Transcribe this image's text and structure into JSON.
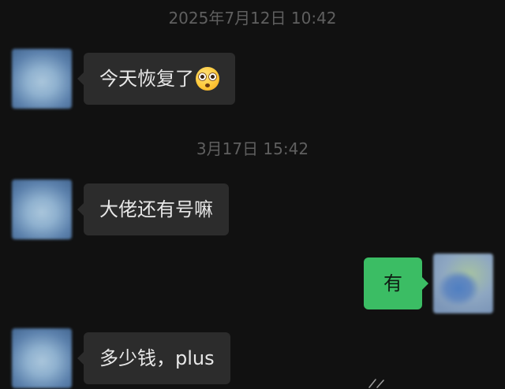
{
  "chat": {
    "messages": [
      {
        "type": "timestamp",
        "text": "2025年7月12日 10:42"
      },
      {
        "type": "incoming",
        "text": "今天恢复了",
        "emoji": "flushed-face-emoji"
      },
      {
        "type": "timestamp",
        "text": "3月17日 15:42"
      },
      {
        "type": "incoming",
        "text": "大佬还有号嘛"
      },
      {
        "type": "outgoing",
        "text": "有"
      },
      {
        "type": "incoming",
        "text": "多少钱，plus"
      }
    ]
  },
  "colors": {
    "background": "#111111",
    "incoming_bubble": "#2c2c2c",
    "outgoing_bubble": "#3bbd64",
    "timestamp_text": "#5f5f5f"
  }
}
